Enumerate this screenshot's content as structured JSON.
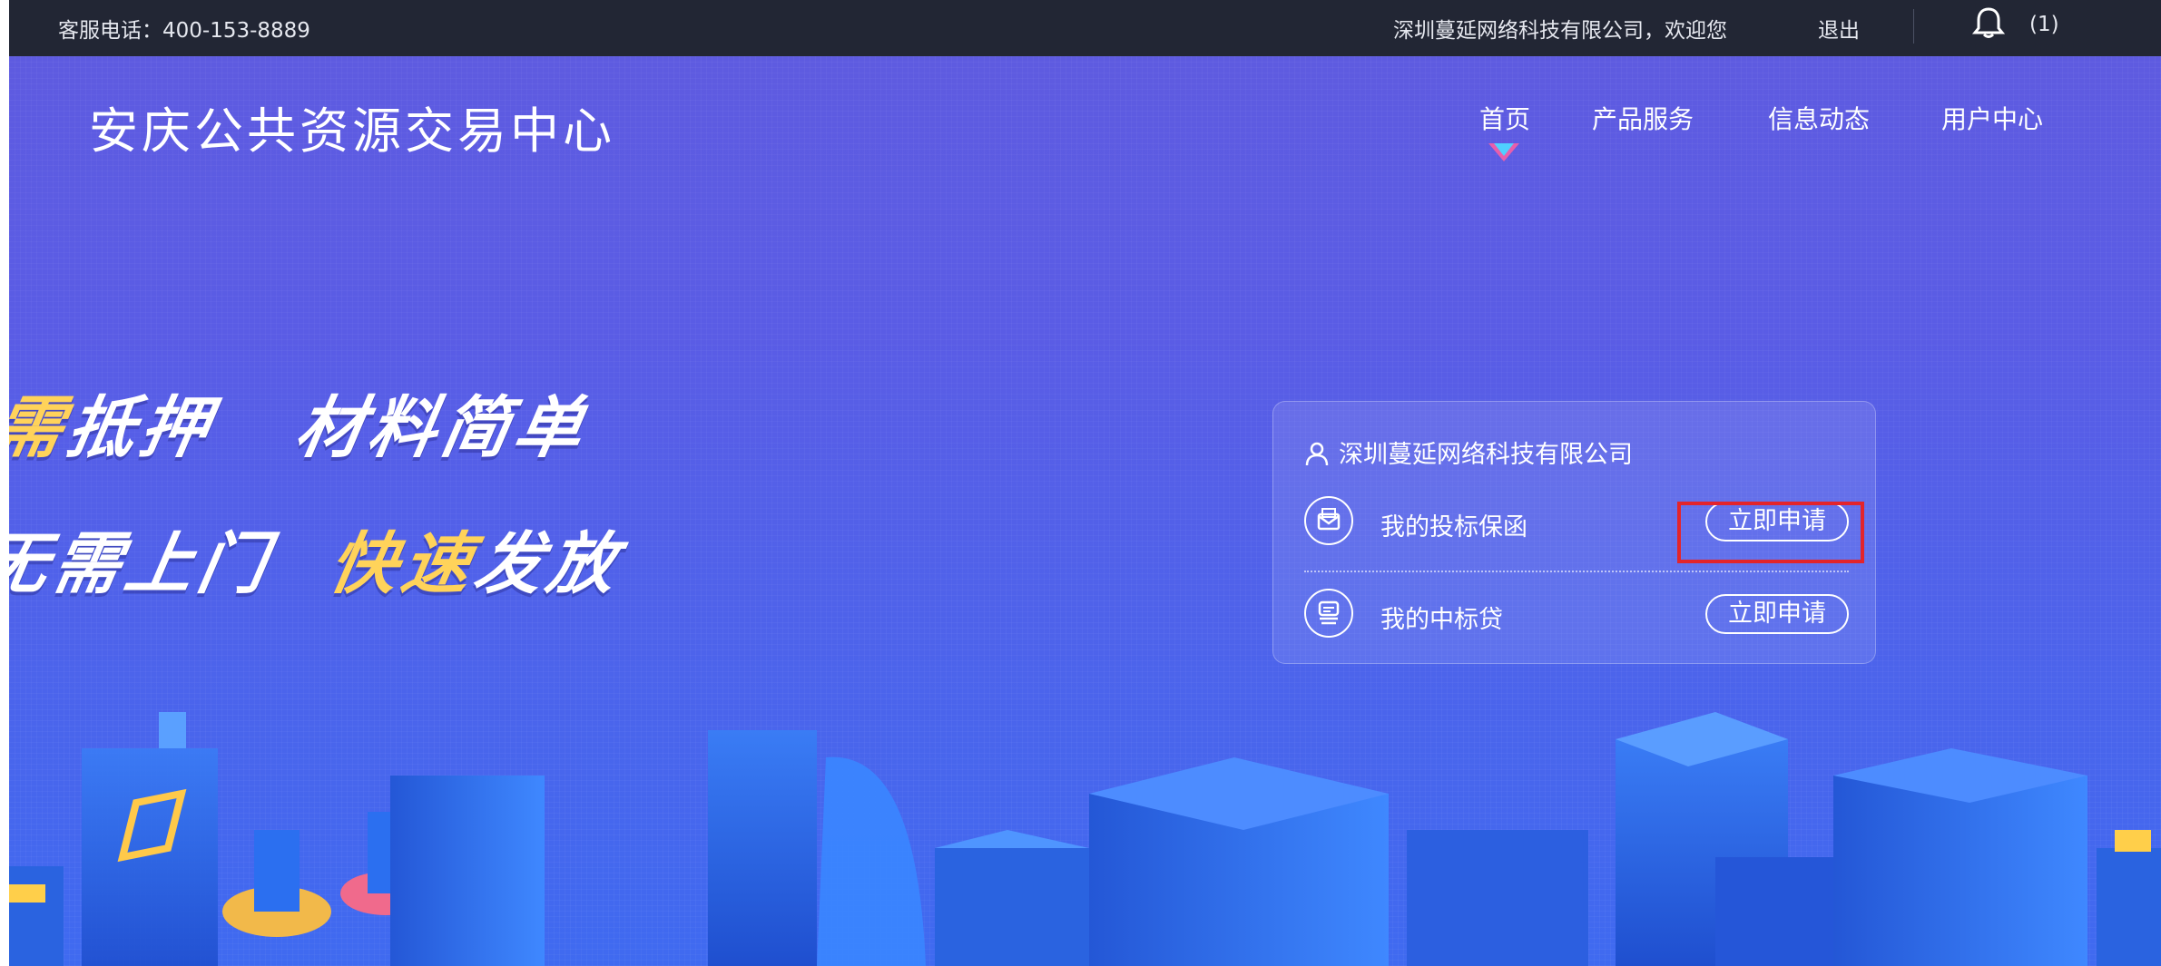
{
  "topbar": {
    "phone_label": "客服电话：400-153-8889",
    "welcome": "深圳蔓延网络科技有限公司，欢迎您",
    "logout": "退出",
    "notice_count": "(1)"
  },
  "header": {
    "site_title": "安庆公共资源交易中心",
    "nav": [
      "首页",
      "产品服务",
      "信息动态",
      "用户中心"
    ],
    "active_nav": "首页"
  },
  "slogans": {
    "line1_a_gold": "需",
    "line1_a_rest": "抵押",
    "line1_b": "材料简单",
    "line2_a": "无需上门",
    "line2_b_gold": "快速",
    "line2_b_rest": "发放"
  },
  "panel": {
    "company": "深圳蔓延网络科技有限公司",
    "rows": [
      {
        "label": "我的投标保函",
        "button": "立即申请"
      },
      {
        "label": "我的中标贷",
        "button": "立即申请"
      }
    ]
  },
  "colors": {
    "topbar_bg": "#222634",
    "hero_top": "#5e5be0",
    "hero_bottom": "#3f6af0",
    "highlight": "#e3242b",
    "slogan_gold": "#ffd35a"
  },
  "icons": [
    "user-icon",
    "bell-icon",
    "envelope-icon",
    "coin-stack-icon"
  ]
}
